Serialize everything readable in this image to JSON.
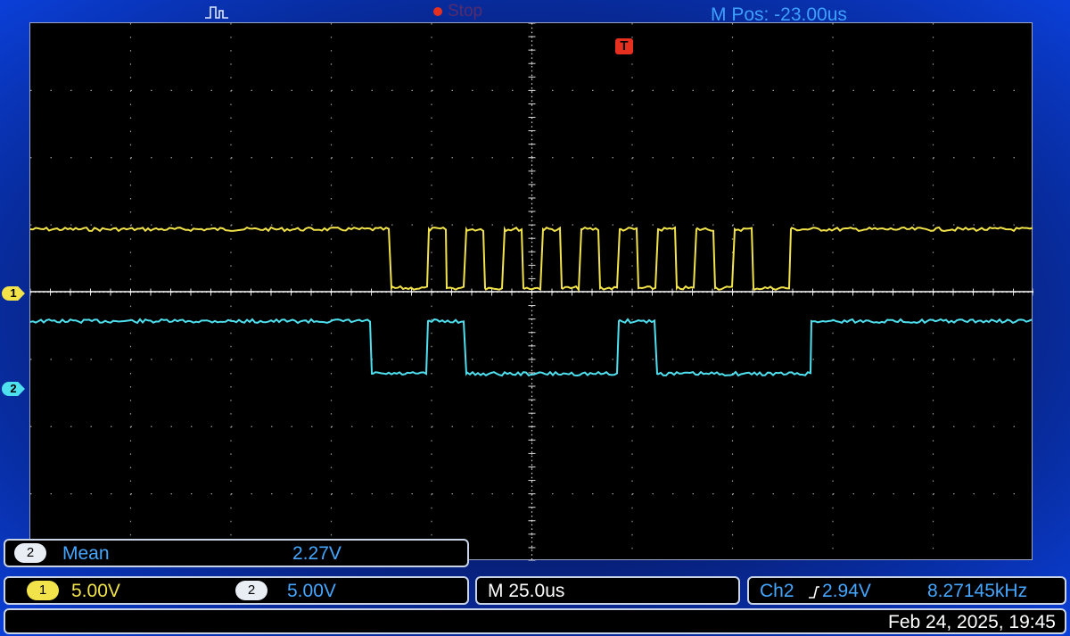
{
  "header": {
    "trigger_status": "Stop",
    "mpos_label": "M Pos: -23.00us"
  },
  "colors": {
    "ch1": "#f2e34a",
    "ch2": "#4fe0f0",
    "label_blue": "#45a6ff",
    "trigger_red": "#e53020",
    "grid": "#bfbfbf"
  },
  "markers": {
    "ch1": "1",
    "ch2": "2",
    "trigger": "T"
  },
  "measurement": {
    "channel": "2",
    "name": "Mean",
    "value": "2.27V"
  },
  "scales": {
    "ch1_num": "1",
    "ch1_volts": "5.00V",
    "ch2_num": "2",
    "ch2_volts": "5.00V",
    "timebase": "M 25.0us",
    "trigger_source": "Ch2",
    "trigger_slope_icon": "rising-edge-icon",
    "trigger_level": "2.94V",
    "frequency": "8.27145kHz"
  },
  "footer": {
    "datetime": "Feb 24, 2025, 19:45"
  },
  "waveforms": {
    "ch1_bits_lowhigh": [
      1,
      0,
      1,
      0,
      1,
      0,
      1,
      0,
      1,
      0,
      1,
      0,
      1,
      0,
      1,
      0,
      1,
      0,
      1,
      0,
      1
    ],
    "ch2_bits_lowhigh": [
      1,
      0,
      1,
      0,
      1,
      0,
      1
    ]
  }
}
